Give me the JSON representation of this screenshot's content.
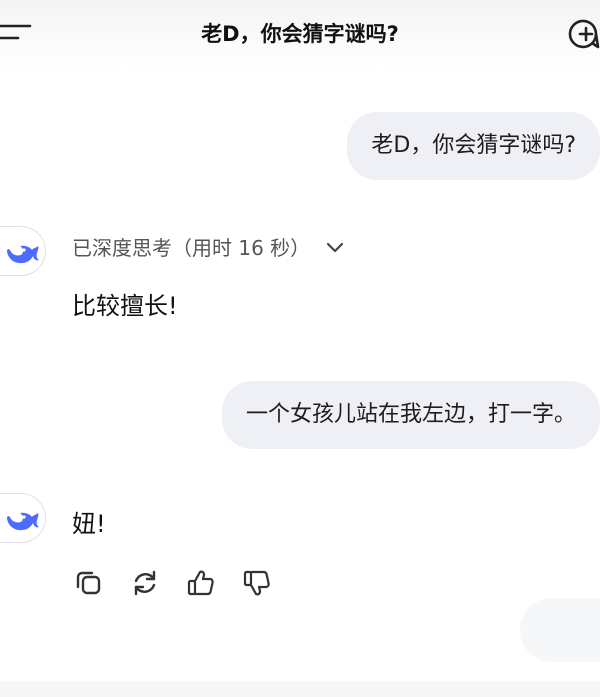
{
  "header": {
    "title": "老D，你会猜字谜吗?",
    "menu_icon": "menu-icon",
    "new_chat_icon": "new-chat-icon"
  },
  "messages": [
    {
      "role": "user",
      "text": "老D，你会猜字谜吗?"
    },
    {
      "role": "assistant",
      "avatar_icon": "whale-logo-icon",
      "thinking_label": "已深度思考（用时 16 秒）",
      "text": "比较擅长!"
    },
    {
      "role": "user",
      "text": "一个女孩儿站在我左边，打一字。"
    },
    {
      "role": "assistant",
      "avatar_icon": "whale-logo-icon",
      "text": "妞!",
      "actions": [
        "copy-icon",
        "regenerate-icon",
        "thumbs-up-icon",
        "thumbs-down-icon"
      ]
    }
  ],
  "colors": {
    "brand": "#4d6bfe",
    "bubble": "#eef0f6",
    "icon": "#333333"
  }
}
